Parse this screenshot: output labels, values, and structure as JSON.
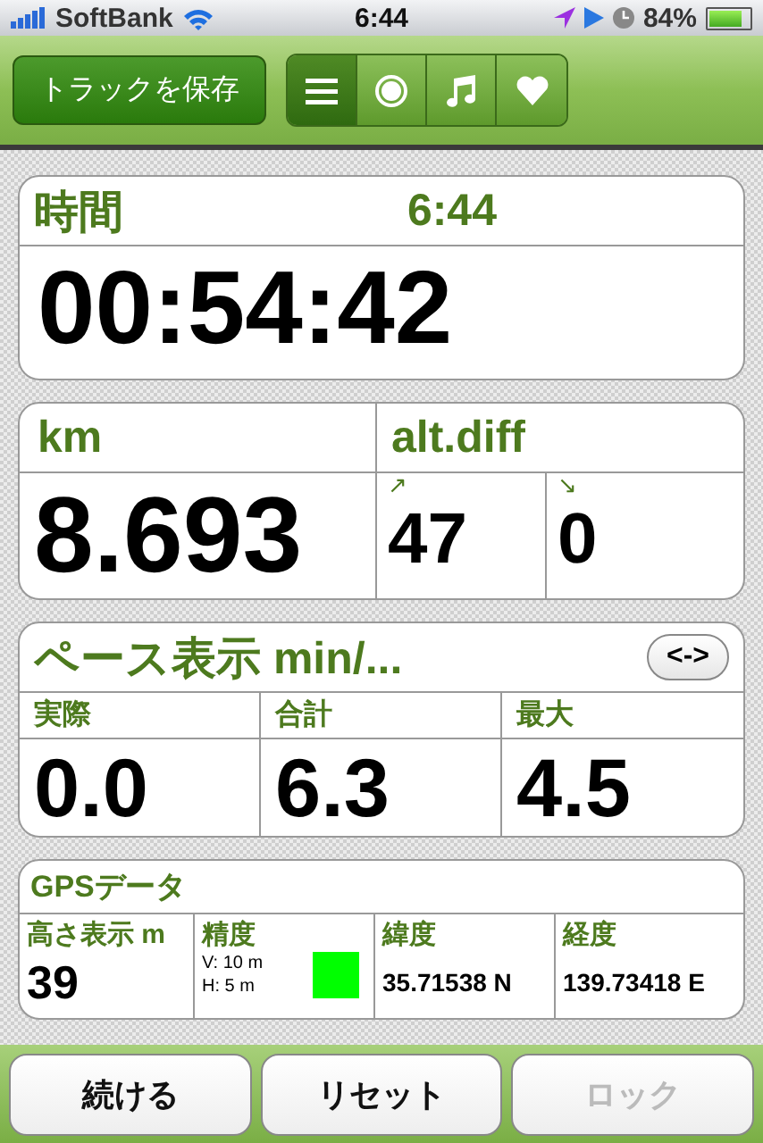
{
  "status_bar": {
    "carrier": "SoftBank",
    "time": "6:44",
    "battery": "84%"
  },
  "toolbar": {
    "save_button": "トラックを保存",
    "segments": [
      {
        "kind": "list",
        "selected": true
      },
      {
        "kind": "record",
        "selected": false
      },
      {
        "kind": "music",
        "selected": false
      },
      {
        "kind": "heart",
        "selected": false
      }
    ]
  },
  "time_card": {
    "label": "時間",
    "clock": "6:44",
    "elapsed": "00:54:42"
  },
  "distance_card": {
    "label": "km",
    "value": "8.693",
    "alt_label": "alt.diff",
    "ascent": {
      "arrow": "↗",
      "value": "47"
    },
    "descent": {
      "arrow": "↘",
      "value": "0"
    }
  },
  "pace_card": {
    "title": "ペース表示 min/...",
    "toggle_button": "<->",
    "columns": [
      {
        "label": "実際",
        "value": "0.0"
      },
      {
        "label": "合計",
        "value": "6.3"
      },
      {
        "label": "最大",
        "value": "4.5"
      }
    ]
  },
  "gps_card": {
    "title": "GPSデータ",
    "altitude": {
      "label": "高さ表示 m",
      "value": "39"
    },
    "accuracy": {
      "label": "精度",
      "vertical": "V: 10 m",
      "horizontal": "H: 5 m",
      "color": "#00ff00"
    },
    "latitude": {
      "label": "緯度",
      "value": "35.71538 N"
    },
    "longitude": {
      "label": "経度",
      "value": "139.73418 E"
    }
  },
  "buttons": [
    {
      "label": "続ける",
      "disabled": false
    },
    {
      "label": "リセット",
      "disabled": false
    },
    {
      "label": "ロック",
      "disabled": true
    }
  ]
}
